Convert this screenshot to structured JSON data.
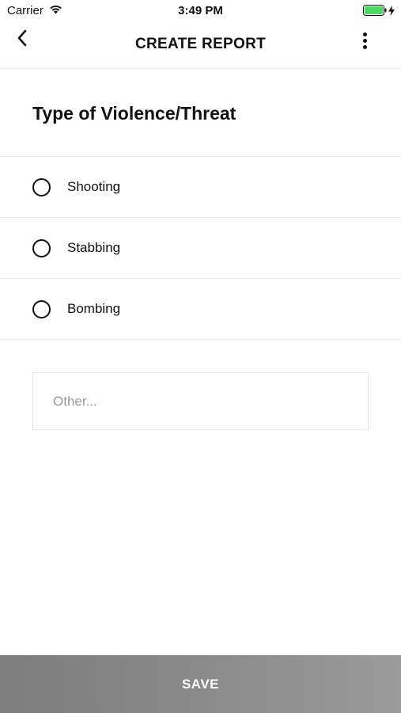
{
  "status_bar": {
    "carrier": "Carrier",
    "time": "3:49 PM",
    "battery_color": "#4cd964"
  },
  "nav": {
    "title": "CREATE REPORT",
    "back_icon": "chevron-left-icon",
    "more_icon": "more-vertical-icon"
  },
  "section": {
    "title": "Type of Violence/Threat"
  },
  "options": [
    {
      "label": "Shooting",
      "selected": false
    },
    {
      "label": "Stabbing",
      "selected": false
    },
    {
      "label": "Bombing",
      "selected": false
    }
  ],
  "other": {
    "placeholder": "Other...",
    "value": ""
  },
  "save": {
    "label": "SAVE"
  }
}
